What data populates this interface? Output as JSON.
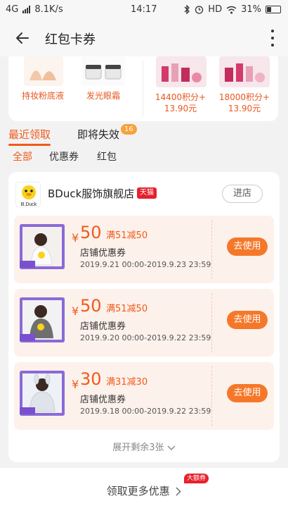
{
  "status_bar": {
    "network": "4G",
    "speed": "8.1K/s",
    "time": "14:17",
    "hd": "HD",
    "battery": "31%"
  },
  "app_bar": {
    "title": "红包卡券"
  },
  "promo": {
    "items": [
      {
        "caption": "持妆粉底液"
      },
      {
        "caption": "发光眼霜"
      },
      {
        "line1": "14400积分+",
        "line2": "13.90元"
      },
      {
        "line1": "18000积分+",
        "line2": "13.90元"
      }
    ]
  },
  "tabs": [
    {
      "label": "最近领取",
      "active": true
    },
    {
      "label": "即将失效",
      "badge": "16"
    }
  ],
  "filters": [
    {
      "label": "全部",
      "active": true
    },
    {
      "label": "优惠券"
    },
    {
      "label": "红包"
    }
  ],
  "store": {
    "name": "BDuck服饰旗舰店",
    "badge": "天猫",
    "enter_label": "进店",
    "logo_text": "B.Duck",
    "coupons": [
      {
        "currency": "¥",
        "amount": "50",
        "condition": "满51减50",
        "type": "店铺优惠券",
        "validity": "2019.9.21 00:00-2019.9.23 23:59",
        "action": "去使用"
      },
      {
        "currency": "¥",
        "amount": "50",
        "condition": "满51减50",
        "type": "店铺优惠券",
        "validity": "2019.9.20 00:00-2019.9.22 23:59",
        "action": "去使用"
      },
      {
        "currency": "¥",
        "amount": "30",
        "condition": "满31减30",
        "type": "店铺优惠券",
        "validity": "2019.9.18 00:00-2019.9.22 23:59",
        "action": "去使用"
      }
    ],
    "expand_label": "展开剩余3张"
  },
  "footer": {
    "more_label": "领取更多优惠",
    "badge": "大额券"
  },
  "colors": {
    "accent": "#f05a1a",
    "use_button": "#f5782a",
    "coupon_bg": "#fdf1eb",
    "tmall_red": "#e5202d",
    "badge_orange": "#f7a23b"
  }
}
